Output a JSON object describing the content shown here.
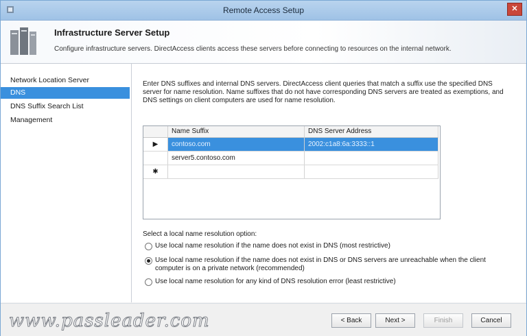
{
  "window": {
    "title": "Remote Access Setup"
  },
  "header": {
    "title": "Infrastructure Server Setup",
    "description": "Configure infrastructure servers. DirectAccess clients access these servers before connecting to resources on the internal network."
  },
  "nav": {
    "items": [
      {
        "label": "Network Location Server"
      },
      {
        "label": "DNS"
      },
      {
        "label": "DNS Suffix Search List"
      },
      {
        "label": "Management"
      }
    ]
  },
  "instructions": "Enter DNS suffixes and internal DNS servers.  DirectAccess client queries that match a suffix use the specified DNS server for name resolution. Name suffixes that do not have corresponding DNS servers are treated as exemptions, and DNS settings on client computers are used for name resolution.",
  "grid": {
    "columns": [
      "Name Suffix",
      "DNS Server Address"
    ],
    "rows": [
      {
        "marker": "▶",
        "suffix": "contoso.com",
        "server": "2002:c1a8:6a:3333::1"
      },
      {
        "marker": "",
        "suffix": "server5.contoso.com",
        "server": ""
      },
      {
        "marker": "✱",
        "suffix": "",
        "server": ""
      }
    ]
  },
  "resolution": {
    "label": "Select a local name resolution option:",
    "options": [
      {
        "text": "Use local name resolution if the name does not exist in DNS (most restrictive)",
        "selected": false
      },
      {
        "text": "Use local name resolution if the name does not exist in DNS or DNS servers are unreachable when the client computer is on a private network (recommended)",
        "selected": true
      },
      {
        "text": "Use local name resolution for any kind of DNS resolution error (least restrictive)",
        "selected": false
      }
    ]
  },
  "footer": {
    "watermark": "www.passleader.com",
    "back": "< Back",
    "next": "Next >",
    "finish": "Finish",
    "cancel": "Cancel"
  }
}
